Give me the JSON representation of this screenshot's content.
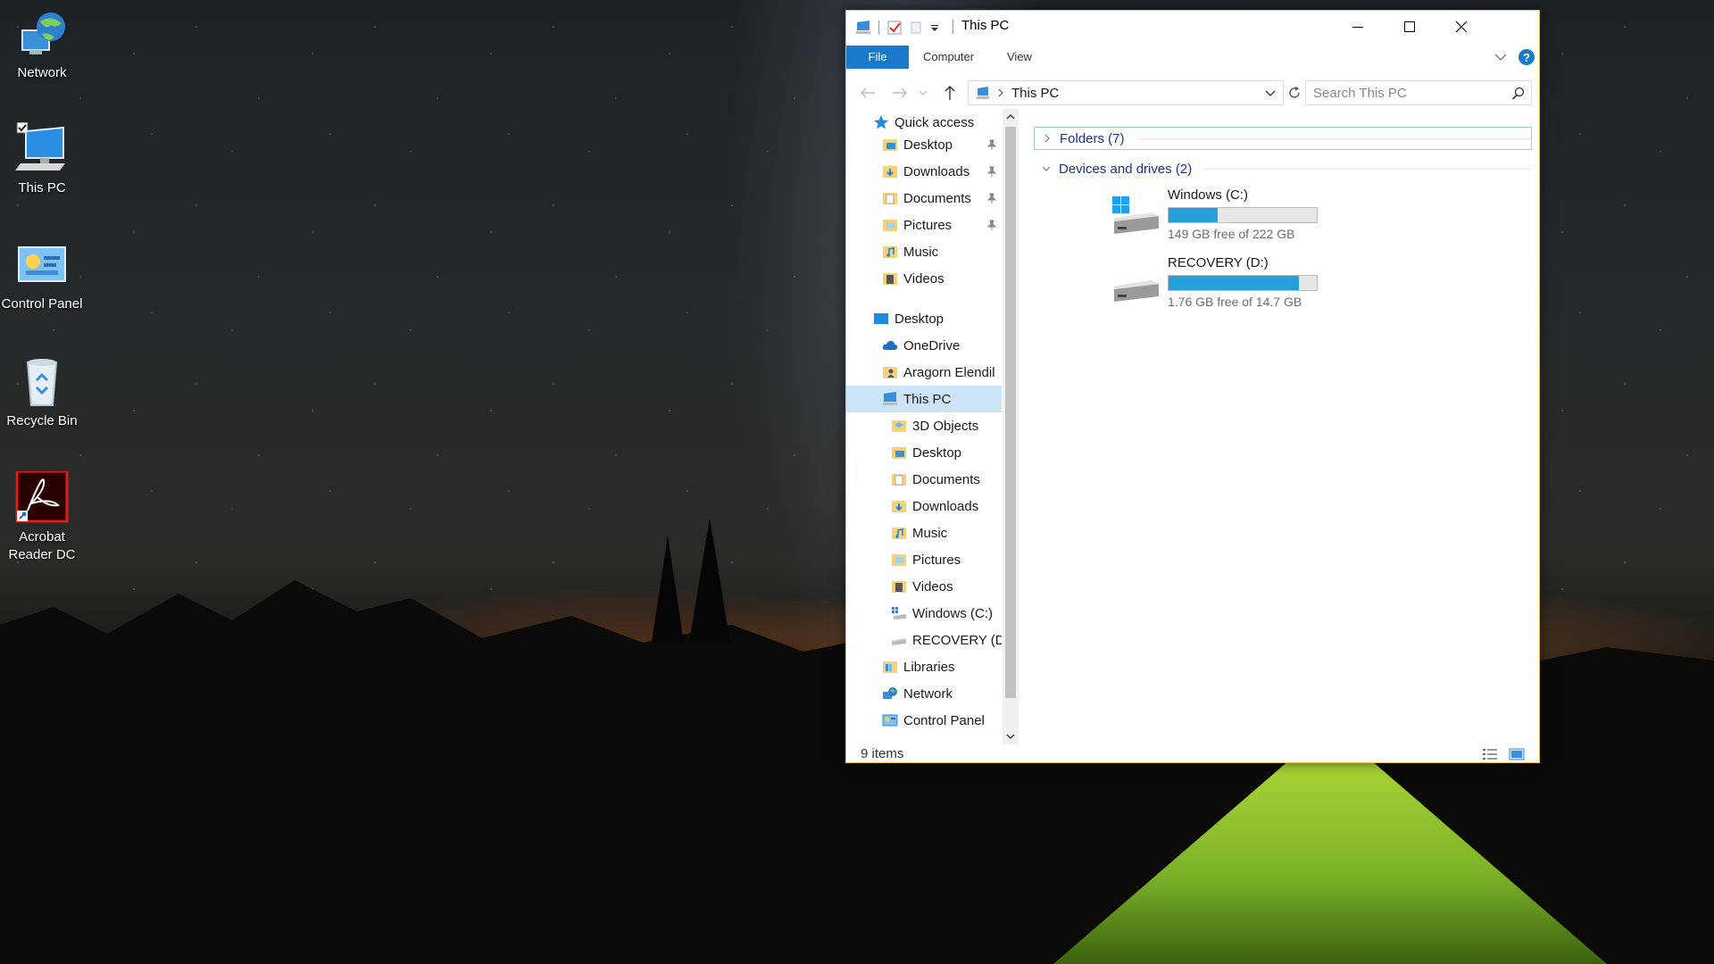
{
  "desktop": {
    "icons": [
      {
        "label": "Network"
      },
      {
        "label": "This PC"
      },
      {
        "label": "Control Panel"
      },
      {
        "label": "Recycle Bin"
      },
      {
        "label": "Acrobat\nReader DC"
      }
    ]
  },
  "window": {
    "title": "This PC",
    "ribbon": {
      "file": "File",
      "tabs": [
        "Computer",
        "View"
      ]
    },
    "address": {
      "path": "This PC",
      "search_placeholder": "Search This PC"
    },
    "nav": {
      "quick_access": "Quick access",
      "quick_items": [
        "Desktop",
        "Downloads",
        "Documents",
        "Pictures",
        "Music",
        "Videos"
      ],
      "desktop": "Desktop",
      "onedrive": "OneDrive",
      "user": "Aragorn Elendil",
      "this_pc": "This PC",
      "pc_items": [
        "3D Objects",
        "Desktop",
        "Documents",
        "Downloads",
        "Music",
        "Pictures",
        "Videos",
        "Windows (C:)",
        "RECOVERY (D:)"
      ],
      "libraries": "Libraries",
      "network": "Network",
      "control_panel": "Control Panel"
    },
    "content": {
      "folders_header": "Folders (7)",
      "devices_header": "Devices and drives (2)",
      "drives": [
        {
          "name": "Windows (C:)",
          "free": "149 GB free of 222 GB",
          "used_fraction": 0.33
        },
        {
          "name": "RECOVERY (D:)",
          "free": "1.76 GB free of 14.7 GB",
          "used_fraction": 0.88
        }
      ]
    },
    "status": {
      "count": "9 items"
    },
    "colors": {
      "accent": "#1979ca",
      "drive_bar": "#26a0da",
      "window_border": "#e7c13b"
    }
  }
}
